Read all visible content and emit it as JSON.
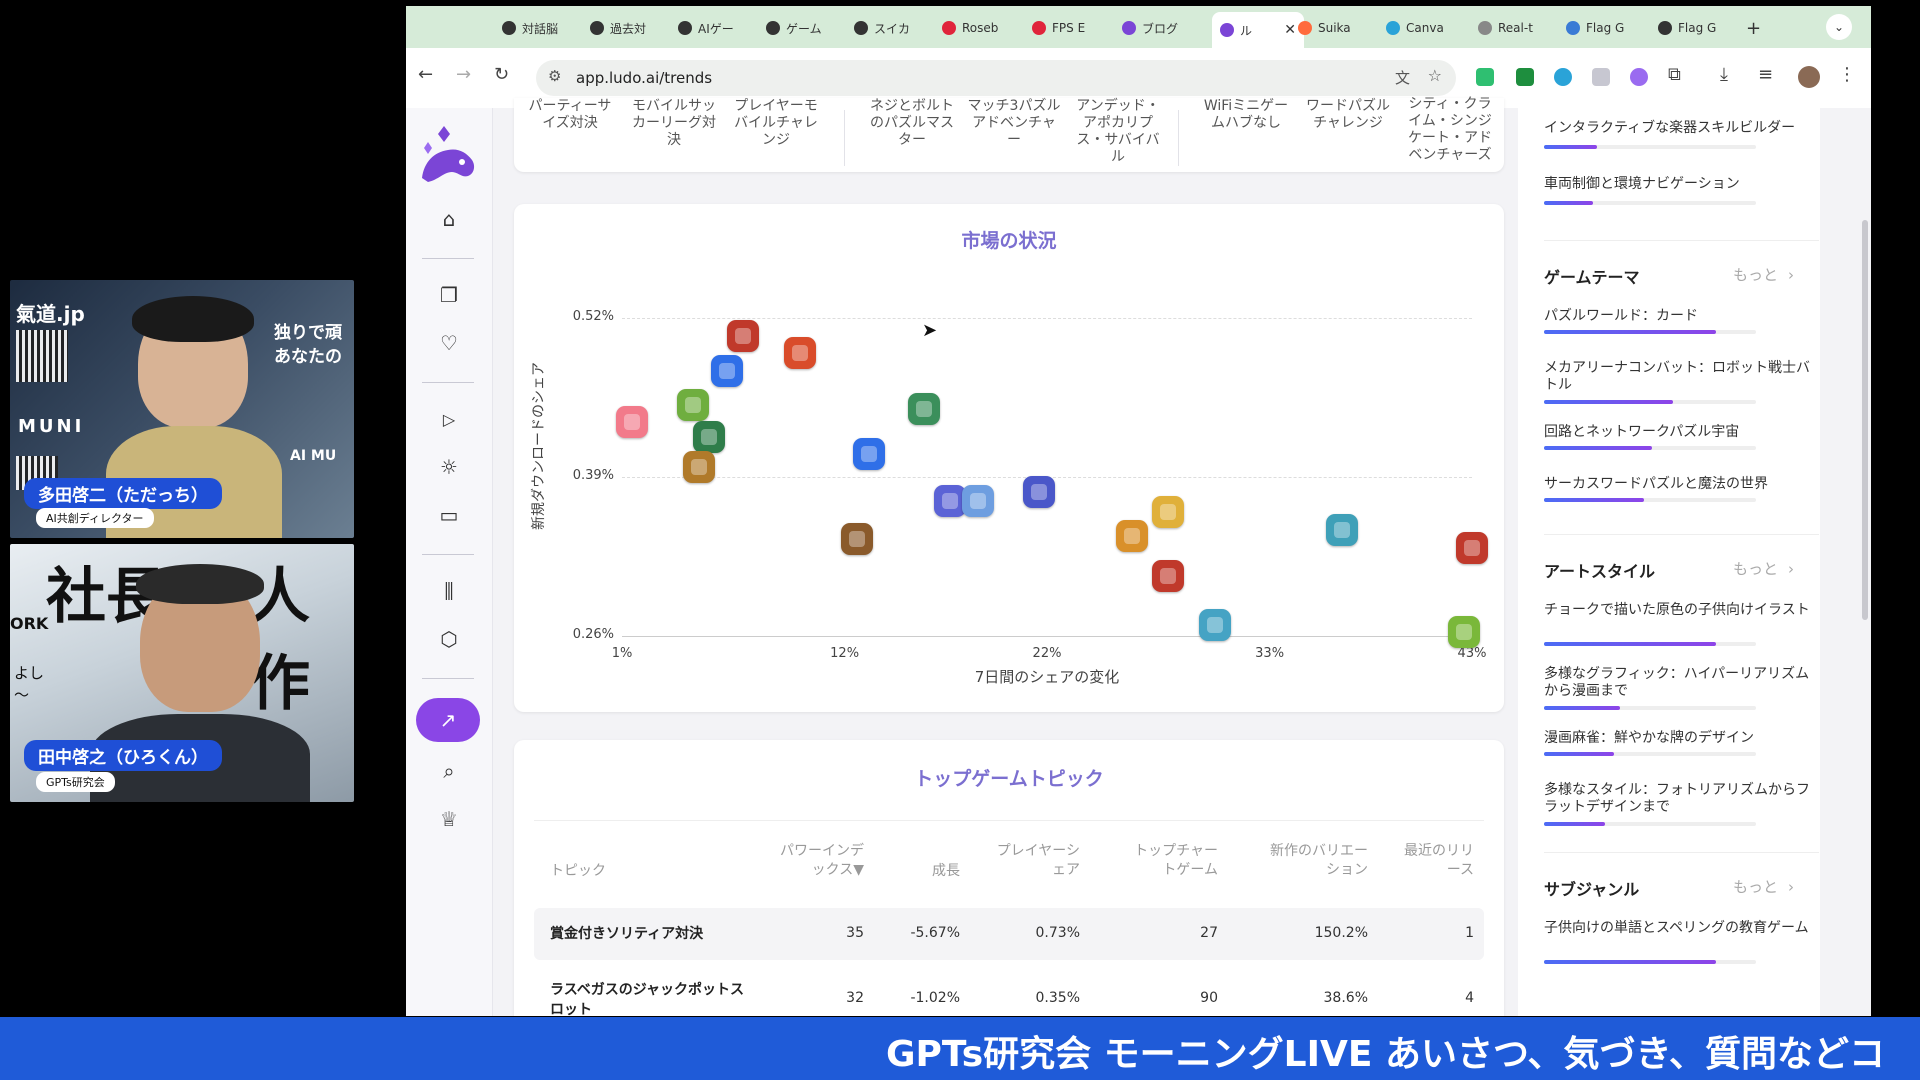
{
  "camera": {
    "top": {
      "name": "多田啓二（ただっち）",
      "role": "AI共創ディレクター",
      "bg_text_1": "氣道.jp",
      "bg_text_2": "独りで頑",
      "bg_text_3": "あなたの",
      "bg_text_4": "MUNI",
      "bg_text_5": "AI MU"
    },
    "bottom": {
      "name": "田中啓之（ひろくん）",
      "role": "GPTs研究会",
      "bg_text_1": "社長",
      "bg_text_2": "人作",
      "bg_text_3": "ORK",
      "bg_text_4": "よし",
      "bg_text_5": "〜"
    }
  },
  "browser": {
    "tabs": [
      {
        "label": "対話脳",
        "fav": "#333333"
      },
      {
        "label": "過去対",
        "fav": "#333333"
      },
      {
        "label": "AIゲー",
        "fav": "#333333"
      },
      {
        "label": "ゲーム",
        "fav": "#333333"
      },
      {
        "label": "スイカ",
        "fav": "#333333"
      },
      {
        "label": "Roseb",
        "fav": "#e0243b"
      },
      {
        "label": "FPS E",
        "fav": "#e0243b"
      },
      {
        "label": "ブログ",
        "fav": "#7b45d6"
      },
      {
        "label": "ル",
        "fav": "#7b45d6",
        "active": true
      },
      {
        "label": "Suika",
        "fav": "#ff6b3d"
      },
      {
        "label": "Canva",
        "fav": "#2aa3d8"
      },
      {
        "label": "Real-t",
        "fav": "#888888"
      },
      {
        "label": "Flag G",
        "fav": "#3a7bd5"
      },
      {
        "label": "Flag G",
        "fav": "#333333"
      }
    ],
    "new_tab": "+",
    "url": "app.ludo.ai/trends"
  },
  "top_header_columns": [
    {
      "text": "パーティーサイズ対決"
    },
    {
      "text": "モバイルサッカーリーグ対決"
    },
    {
      "text": "プレイヤーモバイルチャレンジ"
    },
    {
      "text": "ネジとボルトのパズルマスター"
    },
    {
      "text": "マッチ3パズルアドベンチャー"
    },
    {
      "text": "アンデッド・アポカリプス・サバイバル"
    },
    {
      "text": "WiFiミニゲームハブなし"
    },
    {
      "text": "ワードパズルチャレンジ"
    },
    {
      "text": "シティ・クライム・シンジケート・アドベンチャーズ"
    }
  ],
  "market": {
    "title": "市場の状況",
    "ylabel": "新規ダウンロードのシェア",
    "xlabel": "7日間のシェアの変化"
  },
  "chart_data": {
    "type": "scatter",
    "title": "市場の状況",
    "xlabel": "7日間のシェアの変化",
    "ylabel": "新規ダウンロードのシェア",
    "x_ticks": [
      "1%",
      "12%",
      "22%",
      "33%",
      "43%"
    ],
    "y_ticks": [
      "0.52%",
      "0.39%",
      "0.26%"
    ],
    "xlim": [
      1,
      43
    ],
    "ylim": [
      0.26,
      0.52
    ],
    "points": [
      {
        "x": 1.5,
        "y": 0.435,
        "color": "#f27a8a"
      },
      {
        "x": 4.5,
        "y": 0.449,
        "color": "#6fae3f"
      },
      {
        "x": 5.3,
        "y": 0.423,
        "color": "#2f7d4a"
      },
      {
        "x": 4.8,
        "y": 0.398,
        "color": "#b07a2a"
      },
      {
        "x": 7.0,
        "y": 0.505,
        "color": "#c0392b"
      },
      {
        "x": 6.2,
        "y": 0.477,
        "color": "#2f6fe8"
      },
      {
        "x": 9.8,
        "y": 0.491,
        "color": "#d94c2a"
      },
      {
        "x": 15.9,
        "y": 0.446,
        "color": "#3b8f5b"
      },
      {
        "x": 13.2,
        "y": 0.409,
        "color": "#2f6fe8"
      },
      {
        "x": 12.6,
        "y": 0.339,
        "color": "#8a5a2b"
      },
      {
        "x": 17.2,
        "y": 0.37,
        "color": "#5b63d6"
      },
      {
        "x": 18.6,
        "y": 0.37,
        "color": "#6e9ee0"
      },
      {
        "x": 21.6,
        "y": 0.378,
        "color": "#4a57c9"
      },
      {
        "x": 26.2,
        "y": 0.342,
        "color": "#d9902a"
      },
      {
        "x": 28.0,
        "y": 0.361,
        "color": "#e0b03a"
      },
      {
        "x": 28.0,
        "y": 0.309,
        "color": "#c0392b"
      },
      {
        "x": 30.3,
        "y": 0.269,
        "color": "#45a3c4"
      },
      {
        "x": 36.6,
        "y": 0.347,
        "color": "#3fa0b8"
      },
      {
        "x": 43.0,
        "y": 0.332,
        "color": "#c0392b"
      },
      {
        "x": 42.6,
        "y": 0.263,
        "color": "#7ab83a"
      }
    ]
  },
  "topics": {
    "title": "トップゲームトピック",
    "headers": [
      "トピック",
      "パワーインデックス▼",
      "成長",
      "プレイヤーシェア",
      "トップチャートゲーム",
      "新作のバリエーション",
      "最近のリリース"
    ],
    "rows": [
      {
        "name": "賞金付きソリティア対決",
        "power": "35",
        "growth": "-5.67%",
        "share": "0.73%",
        "top": "27",
        "variation": "150.2%",
        "recent": "1"
      },
      {
        "name": "ラスベガスのジャックポットスロット",
        "power": "32",
        "growth": "-1.02%",
        "share": "0.35%",
        "top": "90",
        "variation": "38.6%",
        "recent": "4"
      }
    ]
  },
  "right_panel": {
    "top_items": [
      {
        "label": "インタラクティブな楽器スキルビルダー",
        "level": 0.25
      },
      {
        "label": "車両制御と環境ナビゲーション",
        "level": 0.23
      }
    ],
    "sections": [
      {
        "title": "ゲームテーマ",
        "more": "もっと",
        "items": [
          {
            "label": "パズルワールド：カード",
            "level": 0.81
          },
          {
            "label": "メカアリーナコンバット：ロボット戦士バトル",
            "level": 0.61
          },
          {
            "label": "回路とネットワークパズル宇宙",
            "level": 0.51
          },
          {
            "label": "サーカスワードパズルと魔法の世界",
            "level": 0.47
          }
        ]
      },
      {
        "title": "アートスタイル",
        "more": "もっと",
        "items": [
          {
            "label": "チョークで描いた原色の子供向けイラスト",
            "level": 0.81
          },
          {
            "label": "多様なグラフィック：ハイパーリアリズムから漫画まで",
            "level": 0.36
          },
          {
            "label": "漫画麻雀：鮮やかな牌のデザイン",
            "level": 0.33
          },
          {
            "label": "多様なスタイル：フォトリアリズムからフラットデザインまで",
            "level": 0.29
          }
        ]
      },
      {
        "title": "サブジャンル",
        "more": "もっと",
        "items": [
          {
            "label": "子供向けの単語とスペリングの教育ゲーム",
            "level": 0.81
          }
        ]
      }
    ]
  },
  "ticker": "GPTs研究会 モーニングLIVE あいさつ、気づき、質問などコ"
}
